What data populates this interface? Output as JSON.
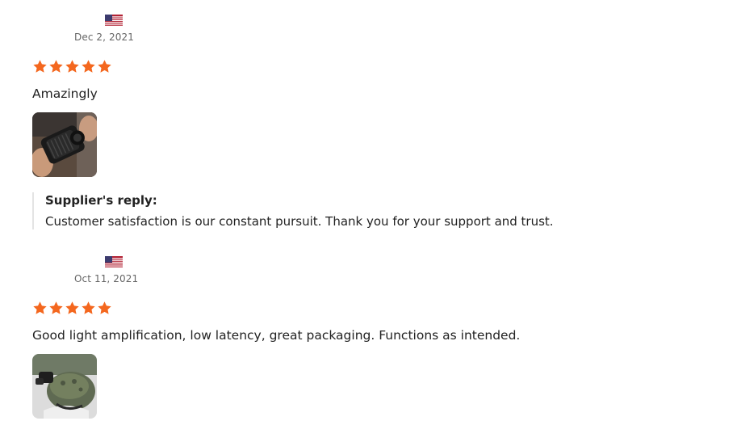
{
  "colors": {
    "star": "#f4671e",
    "flag_red": "#b22234",
    "flag_blue": "#3c3b6e"
  },
  "reviews": [
    {
      "flag_icon": "us-flag-icon",
      "date": "Dec 2, 2021",
      "rating": 5,
      "text": "Amazingly",
      "photo_icon": "review-photo-night-vision",
      "reply": {
        "title": "Supplier's reply:",
        "text": "Customer satisfaction is our constant pursuit. Thank you for your support and trust."
      }
    },
    {
      "flag_icon": "us-flag-icon",
      "date": "Oct 11, 2021",
      "rating": 5,
      "text": "Good light amplification, low latency, great packaging. Functions as intended.",
      "photo_icon": "review-photo-helmet"
    }
  ]
}
